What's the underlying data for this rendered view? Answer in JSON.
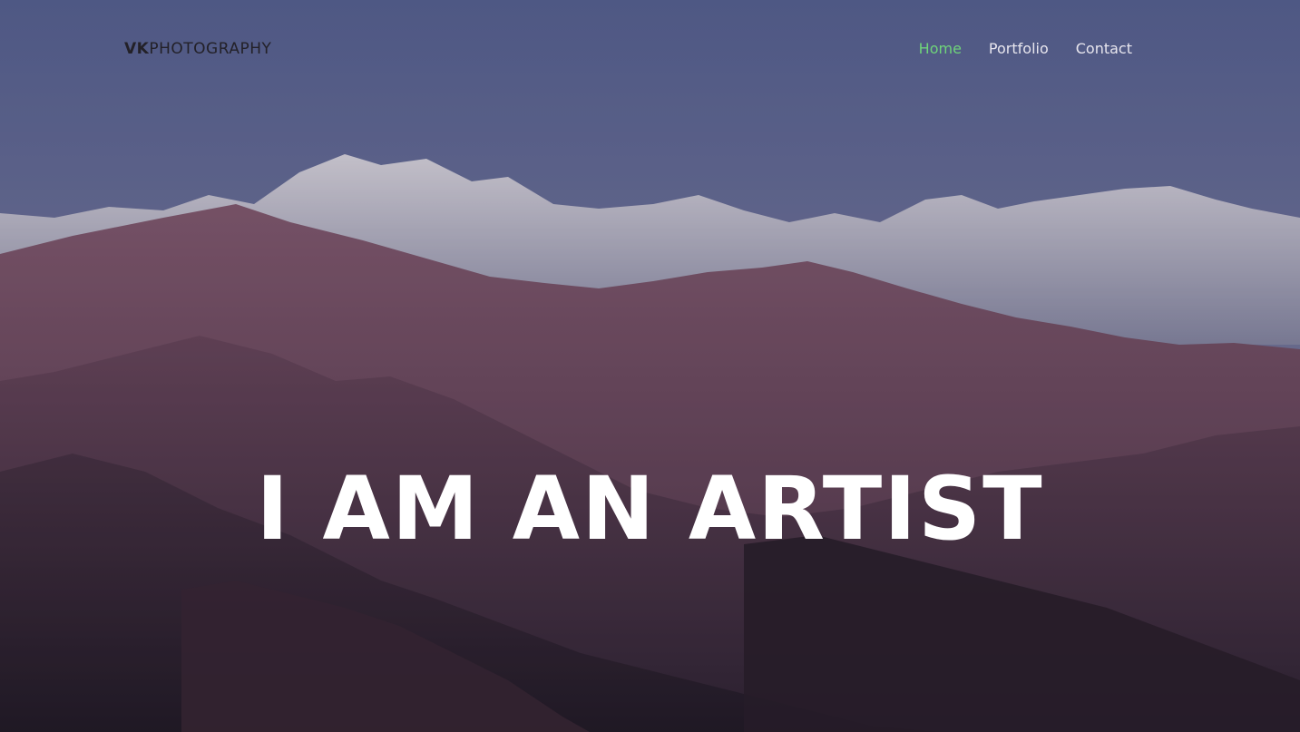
{
  "brand": {
    "bold": "VK",
    "light": "PHOTOGRAPHY"
  },
  "nav": {
    "items": [
      {
        "label": "Home",
        "active": true
      },
      {
        "label": "Portfolio",
        "active": false
      },
      {
        "label": "Contact",
        "active": false
      }
    ]
  },
  "hero": {
    "headline": "I AM AN ARTIST"
  },
  "colors": {
    "accent": "#6fd47a",
    "nav_text": "#e8e6ee",
    "brand_text": "#232128",
    "headline": "#ffffff"
  }
}
